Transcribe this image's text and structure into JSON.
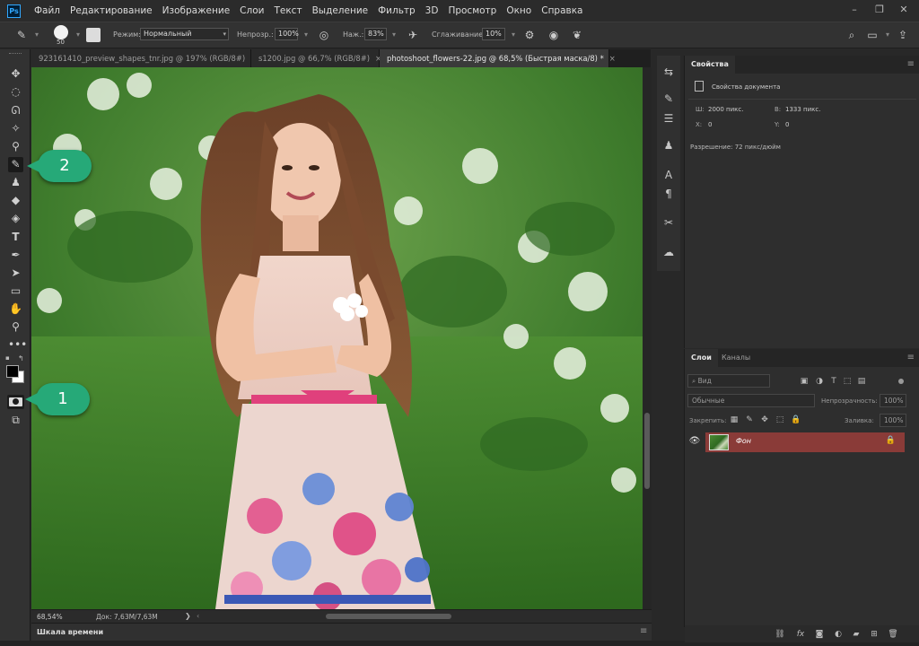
{
  "app": {
    "logo": "Ps"
  },
  "menu": [
    "Файл",
    "Редактирование",
    "Изображение",
    "Слои",
    "Текст",
    "Выделение",
    "Фильтр",
    "3D",
    "Просмотр",
    "Окно",
    "Справка"
  ],
  "options": {
    "brush_size": "50",
    "mode_label": "Режим:",
    "mode_value": "Нормальный",
    "opacity_label": "Непрозр.:",
    "opacity_value": "100%",
    "pressure_label": "Наж.:",
    "pressure_value": "83%",
    "smoothing_label": "Сглаживание:",
    "smoothing_value": "10%"
  },
  "tabs": [
    {
      "label": "923161410_preview_shapes_tnr.jpg @ 197% (RGB/8#)",
      "close": "×"
    },
    {
      "label": "s1200.jpg @ 66,7% (RGB/8#)",
      "close": "×"
    },
    {
      "label": "photoshoot_flowers-22.jpg @ 68,5% (Быстрая маска/8) *",
      "close": "×"
    }
  ],
  "status": {
    "zoom": "68,54%",
    "doc": "Док: 7,63M/7,63M",
    "arrow": "❯"
  },
  "timeline": {
    "label": "Шкала времени"
  },
  "properties": {
    "tab": "Свойства",
    "doc_props": "Свойства документа",
    "w_label": "Ш:",
    "w_value": "2000 пикс.",
    "h_label": "В:",
    "h_value": "1333 пикс.",
    "x_label": "X:",
    "x_value": "0",
    "y_label": "Y:",
    "y_value": "0",
    "resolution": "Разрешение: 72 пикс/дюйм"
  },
  "layers": {
    "tab_layers": "Слои",
    "tab_channels": "Каналы",
    "search": "Вид",
    "blend": "Обычные",
    "opacity_label": "Непрозрачность:",
    "opacity_value": "100%",
    "lock_label": "Закрепить:",
    "fill_label": "Заливка:",
    "fill_value": "100%",
    "layer_name": "Фон"
  },
  "callouts": {
    "one": "1",
    "two": "2"
  },
  "colors": {
    "accent": "#26a978",
    "layer_selected": "#8a3b38",
    "brand": "#31a8ff"
  }
}
